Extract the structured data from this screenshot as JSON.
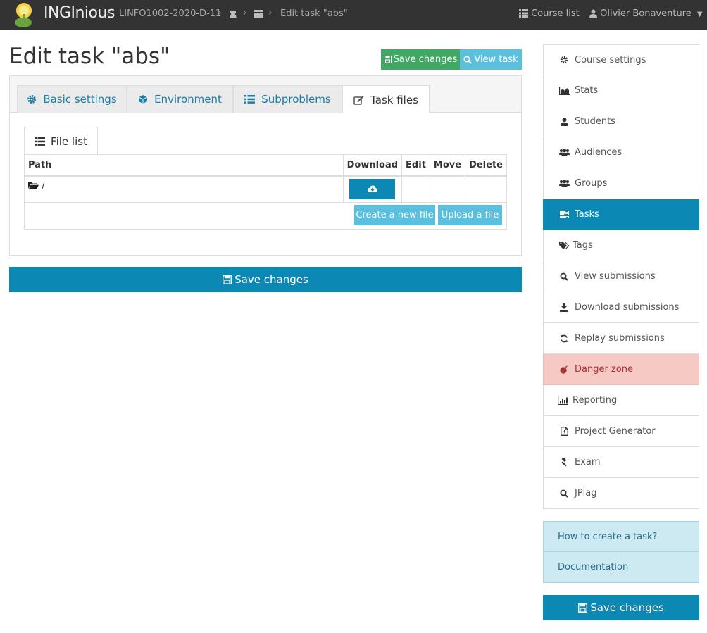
{
  "navbar": {
    "brand": "INGInious",
    "breadcrumb_course": "LINFO1002-2020-D-11",
    "breadcrumb_task": "Edit task \"abs\"",
    "course_list": "Course list",
    "user": "Olivier Bonaventure"
  },
  "page": {
    "title": "Edit task \"abs\"",
    "save_changes": "Save changes",
    "view_task": "View task"
  },
  "tabs": [
    {
      "label": "Basic settings",
      "icon": "gear-icon"
    },
    {
      "label": "Environment",
      "icon": "cube-icon"
    },
    {
      "label": "Subproblems",
      "icon": "list-icon"
    },
    {
      "label": "Task files",
      "icon": "edit-icon"
    }
  ],
  "files": {
    "subtab": "File list",
    "headers": {
      "path": "Path",
      "download": "Download",
      "edit": "Edit",
      "move": "Move",
      "delete": "Delete"
    },
    "rows": [
      {
        "path": "/"
      }
    ],
    "create_file": "Create a new file",
    "upload_file": "Upload a file"
  },
  "save_bottom": "Save changes",
  "sidebar": {
    "items": [
      {
        "label": "Course settings",
        "icon": "gear-icon"
      },
      {
        "label": "Stats",
        "icon": "area-chart-icon"
      },
      {
        "label": "Students",
        "icon": "user-icon"
      },
      {
        "label": "Audiences",
        "icon": "users-icon"
      },
      {
        "label": "Groups",
        "icon": "users-icon"
      },
      {
        "label": "Tasks",
        "icon": "tasks-icon"
      },
      {
        "label": "Tags",
        "icon": "tags-icon"
      },
      {
        "label": "View submissions",
        "icon": "search-icon"
      },
      {
        "label": "Download submissions",
        "icon": "download-icon"
      },
      {
        "label": "Replay submissions",
        "icon": "refresh-icon"
      },
      {
        "label": "Danger zone",
        "icon": "bomb-icon"
      },
      {
        "label": "Reporting",
        "icon": "bar-chart-icon"
      },
      {
        "label": "Project Generator",
        "icon": "file-icon"
      },
      {
        "label": "Exam",
        "icon": "gavel-icon"
      },
      {
        "label": "JPlag",
        "icon": "search-icon"
      }
    ],
    "help": [
      "How to create a task?",
      "Documentation"
    ],
    "save": "Save changes"
  },
  "colors": {
    "navbar": "#333333",
    "primary": "#0b89b4",
    "success": "#3fa863",
    "info": "#5bc0de",
    "danger_bg": "#f7c9c4",
    "help_bg": "#cdeaf2"
  }
}
